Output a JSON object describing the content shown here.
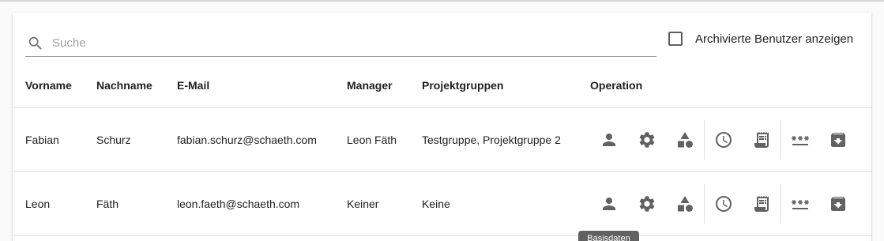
{
  "search": {
    "placeholder": "Suche",
    "value": ""
  },
  "archive_toggle": {
    "label": "Archivierte Benutzer anzeigen",
    "checked": false
  },
  "table": {
    "columns": [
      "Vorname",
      "Nachname",
      "E-Mail",
      "Manager",
      "Projektgruppen",
      "Operation"
    ],
    "rows": [
      {
        "first_name": "Fabian",
        "last_name": "Schurz",
        "email": "fabian.schurz@schaeth.com",
        "manager": "Leon Fäth",
        "groups": "Testgruppe, Projektgruppe 2"
      },
      {
        "first_name": "Leon",
        "last_name": "Fäth",
        "email": "leon.faeth@schaeth.com",
        "manager": "Keiner",
        "groups": "Keine"
      }
    ],
    "operation_icons": [
      "person-icon",
      "gear-icon",
      "shapes-icon",
      "clock-icon",
      "receipt-icon",
      "password-icon",
      "archive-icon"
    ]
  },
  "tooltip": {
    "text": "Basisdaten"
  },
  "colors": {
    "icon": "#616161",
    "divider": "#e0e0e0",
    "tooltip_bg": "#616161"
  }
}
